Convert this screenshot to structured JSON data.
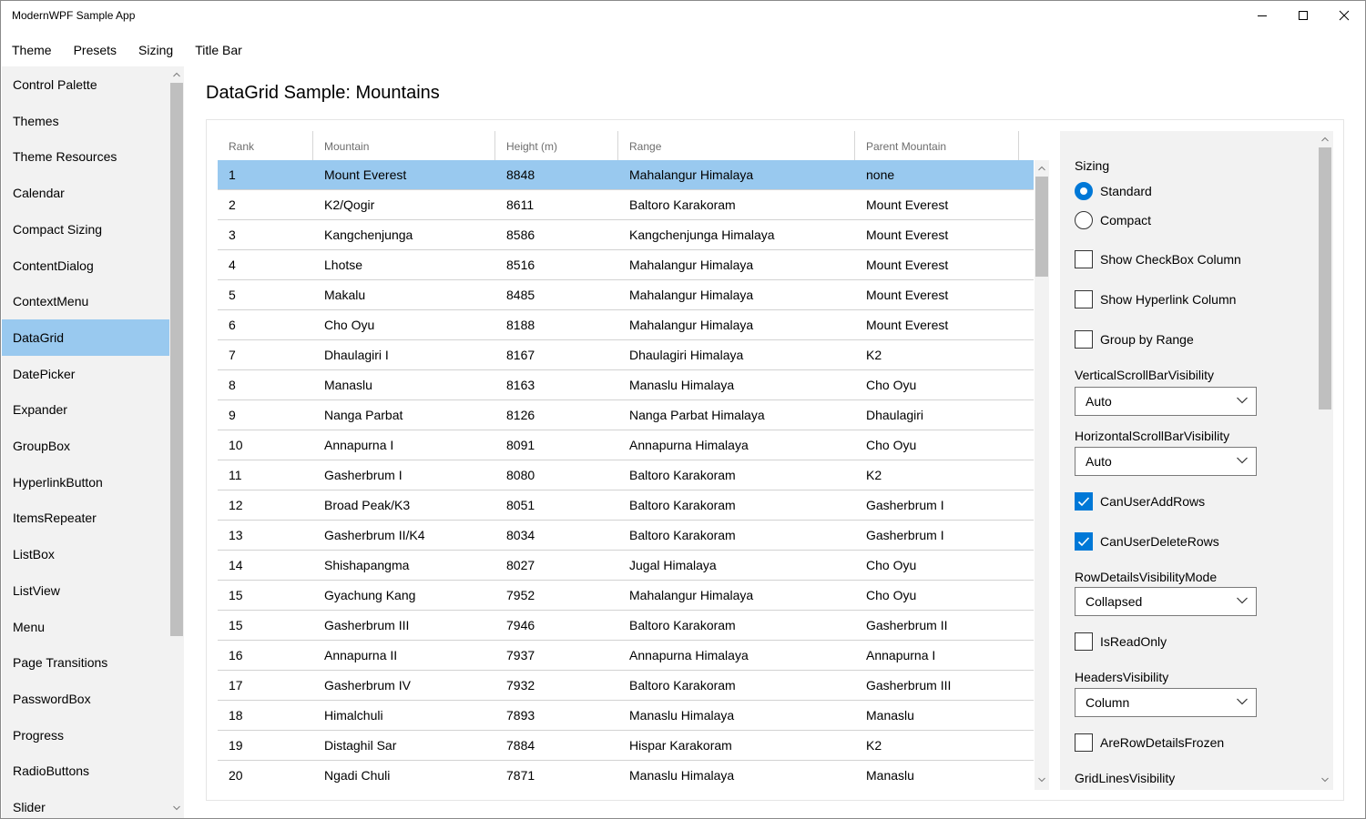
{
  "window": {
    "title": "ModernWPF Sample App",
    "controls": [
      "minimize-icon",
      "maximize-icon",
      "close-icon"
    ]
  },
  "menu": [
    "Theme",
    "Presets",
    "Sizing",
    "Title Bar"
  ],
  "sidebar": {
    "selected": "DataGrid",
    "items": [
      "Control Palette",
      "Themes",
      "Theme Resources",
      "Calendar",
      "Compact Sizing",
      "ContentDialog",
      "ContextMenu",
      "DataGrid",
      "DatePicker",
      "Expander",
      "GroupBox",
      "HyperlinkButton",
      "ItemsRepeater",
      "ListBox",
      "ListView",
      "Menu",
      "Page Transitions",
      "PasswordBox",
      "Progress",
      "RadioButtons",
      "Slider"
    ]
  },
  "page": {
    "title": "DataGrid Sample: Mountains"
  },
  "grid": {
    "columns": [
      "Rank",
      "Mountain",
      "Height (m)",
      "Range",
      "Parent Mountain"
    ],
    "selected_row": 0,
    "rows": [
      [
        "1",
        "Mount Everest",
        "8848",
        "Mahalangur Himalaya",
        "none"
      ],
      [
        "2",
        "K2/Qogir",
        "8611",
        "Baltoro Karakoram",
        "Mount Everest"
      ],
      [
        "3",
        "Kangchenjunga",
        "8586",
        "Kangchenjunga Himalaya",
        "Mount Everest"
      ],
      [
        "4",
        "Lhotse",
        "8516",
        "Mahalangur Himalaya",
        "Mount Everest"
      ],
      [
        "5",
        "Makalu",
        "8485",
        "Mahalangur Himalaya",
        "Mount Everest"
      ],
      [
        "6",
        "Cho Oyu",
        "8188",
        "Mahalangur Himalaya",
        "Mount Everest"
      ],
      [
        "7",
        "Dhaulagiri I",
        "8167",
        "Dhaulagiri Himalaya",
        "K2"
      ],
      [
        "8",
        "Manaslu",
        "8163",
        "Manaslu Himalaya",
        "Cho Oyu"
      ],
      [
        "9",
        "Nanga Parbat",
        "8126",
        "Nanga Parbat Himalaya",
        "Dhaulagiri"
      ],
      [
        "10",
        "Annapurna I",
        "8091",
        "Annapurna Himalaya",
        "Cho Oyu"
      ],
      [
        "11",
        "Gasherbrum I",
        "8080",
        "Baltoro Karakoram",
        "K2"
      ],
      [
        "12",
        "Broad Peak/K3",
        "8051",
        "Baltoro Karakoram",
        "Gasherbrum I"
      ],
      [
        "13",
        "Gasherbrum II/K4",
        "8034",
        "Baltoro Karakoram",
        "Gasherbrum I"
      ],
      [
        "14",
        "Shishapangma",
        "8027",
        "Jugal Himalaya",
        "Cho Oyu"
      ],
      [
        "15",
        "Gyachung Kang",
        "7952",
        "Mahalangur Himalaya",
        "Cho Oyu"
      ],
      [
        "15",
        "Gasherbrum III",
        "7946",
        "Baltoro Karakoram",
        "Gasherbrum II"
      ],
      [
        "16",
        "Annapurna II",
        "7937",
        "Annapurna Himalaya",
        "Annapurna I"
      ],
      [
        "17",
        "Gasherbrum IV",
        "7932",
        "Baltoro Karakoram",
        "Gasherbrum III"
      ],
      [
        "18",
        "Himalchuli",
        "7893",
        "Manaslu Himalaya",
        "Manaslu"
      ],
      [
        "19",
        "Distaghil Sar",
        "7884",
        "Hispar Karakoram",
        "K2"
      ],
      [
        "20",
        "Ngadi Chuli",
        "7871",
        "Manaslu Himalaya",
        "Manaslu"
      ]
    ]
  },
  "options": {
    "sizing": {
      "label": "Sizing",
      "standard": {
        "label": "Standard",
        "checked": true
      },
      "compact": {
        "label": "Compact",
        "checked": false
      }
    },
    "show_checkbox_column": {
      "label": "Show CheckBox Column",
      "checked": false
    },
    "show_hyperlink_column": {
      "label": "Show Hyperlink Column",
      "checked": false
    },
    "group_by_range": {
      "label": "Group by Range",
      "checked": false
    },
    "vertical_scrollbar": {
      "label": "VerticalScrollBarVisibility",
      "value": "Auto"
    },
    "horizontal_scrollbar": {
      "label": "HorizontalScrollBarVisibility",
      "value": "Auto"
    },
    "can_user_add_rows": {
      "label": "CanUserAddRows",
      "checked": true
    },
    "can_user_delete_rows": {
      "label": "CanUserDeleteRows",
      "checked": true
    },
    "row_details_mode": {
      "label": "RowDetailsVisibilityMode",
      "value": "Collapsed"
    },
    "is_read_only": {
      "label": "IsReadOnly",
      "checked": false
    },
    "headers_visibility": {
      "label": "HeadersVisibility",
      "value": "Column"
    },
    "are_row_details_frozen": {
      "label": "AreRowDetailsFrozen",
      "checked": false
    },
    "grid_lines_visibility": {
      "label": "GridLinesVisibility"
    }
  },
  "colors": {
    "accent": "#0078d7",
    "selection": "#99c9ef",
    "panel_bg": "#f2f2f2",
    "scroll_thumb": "#bfbfbf"
  }
}
